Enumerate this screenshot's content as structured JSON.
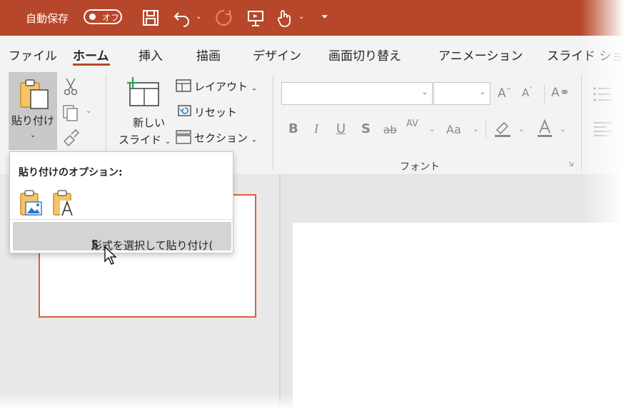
{
  "titlebar": {
    "autosave_label": "自動保存",
    "autosave_state": "オフ",
    "bg_color": "#b7472a",
    "icons": [
      "save-icon",
      "undo-icon",
      "redo-icon",
      "present-icon",
      "touch-mode-icon",
      "customize-qat-icon"
    ]
  },
  "tabs": [
    {
      "label": "ファイル"
    },
    {
      "label": "ホーム",
      "active": true
    },
    {
      "label": "挿入"
    },
    {
      "label": "描画"
    },
    {
      "label": "デザイン"
    },
    {
      "label": "画面切り替え"
    },
    {
      "label": "アニメーション"
    },
    {
      "label": "スライド ショー"
    }
  ],
  "clipboard": {
    "paste_label": "貼り付け"
  },
  "slides": {
    "new_slide_line1": "新しい",
    "new_slide_line2": "スライド",
    "layout_label": "レイアウト",
    "reset_label": "リセット",
    "section_label": "セクション"
  },
  "font": {
    "group_label": "フォント",
    "font_name_value": "",
    "font_size_value": ""
  },
  "paste_menu": {
    "heading": "貼り付けのオプション:",
    "special_prefix": "形式を選択して貼り付け(",
    "special_key": "S",
    "special_suffix": ")..."
  },
  "colors": {
    "accent": "#b7472a",
    "selection_border": "#e05d44"
  }
}
